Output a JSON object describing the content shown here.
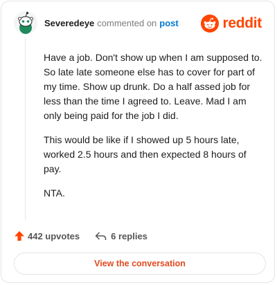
{
  "header": {
    "username": "Severedeye",
    "action": "commented on",
    "link": "post",
    "brand": "reddit",
    "brand_color": "#ff4500",
    "avatar_icon": "snoo-avatar-icon",
    "logo_icon": "reddit-alien-icon"
  },
  "comment": {
    "paragraphs": [
      "Have a job. Don't show up when I am supposed to. So late late someone else has to cover for part of my time. Show up drunk. Do a half assed job for less than the time I agreed to. Leave. Mad I am only being paid for the job I did.",
      "This would be like if I showed up 5 hours late, worked 2.5 hours and then expected 8 hours of pay.",
      "NTA."
    ]
  },
  "footer": {
    "upvotes_label": "442 upvotes",
    "replies_label": "6 replies",
    "upvote_icon": "upvote-arrow-icon",
    "reply_icon": "reply-arrow-icon"
  },
  "cta": {
    "label": "View the conversation"
  }
}
